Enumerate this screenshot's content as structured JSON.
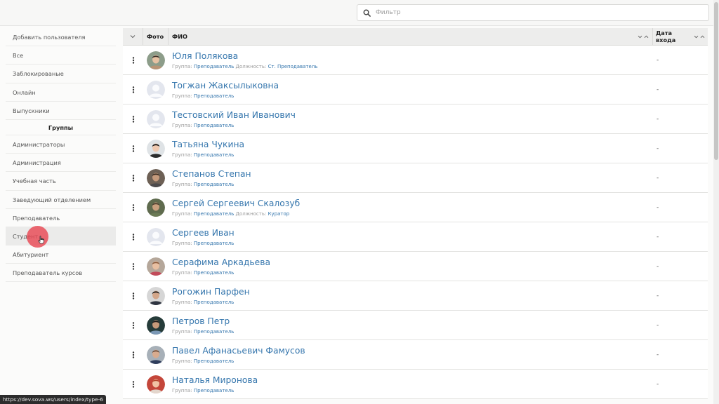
{
  "filter": {
    "placeholder": "Фильтр",
    "value": ""
  },
  "sidebar": {
    "items": [
      {
        "label": "Добавить пользователя"
      },
      {
        "label": "Все"
      },
      {
        "label": "Заблокированые"
      },
      {
        "label": "Онлайн"
      },
      {
        "label": "Выпускники"
      }
    ],
    "groups_header": "Группы",
    "groups": [
      {
        "label": "Администраторы"
      },
      {
        "label": "Администрация"
      },
      {
        "label": "Учебная часть"
      },
      {
        "label": "Заведующий отделением"
      },
      {
        "label": "Преподаватель"
      },
      {
        "label": "Студент",
        "active": true
      },
      {
        "label": "Абитуриент"
      },
      {
        "label": "Преподаватель курсов"
      }
    ]
  },
  "table": {
    "headers": {
      "photo": "Фото",
      "fio": "ФИО",
      "date": "Дата входа"
    },
    "rows": [
      {
        "name": "Юля Полякова",
        "group_label": "Группа:",
        "group": "Преподаватель",
        "position_label": "Должность:",
        "position": "Ст. Преподаватель",
        "date": "-",
        "avatar": "photo-1"
      },
      {
        "name": "Тогжан Жаксылыковна",
        "group_label": "Группа:",
        "group": "Преподаватель",
        "date": "-",
        "avatar": "placeholder"
      },
      {
        "name": "Тестовский Иван Иванович",
        "group_label": "Группа:",
        "group": "Преподаватель",
        "date": "-",
        "avatar": "placeholder"
      },
      {
        "name": "Татьяна Чукина",
        "group_label": "Группа:",
        "group": "Преподаватель",
        "date": "-",
        "avatar": "photo-2"
      },
      {
        "name": "Степанов Степан",
        "group_label": "Группа:",
        "group": "Преподаватель",
        "date": "-",
        "avatar": "photo-3"
      },
      {
        "name": "Сергей Сергеевич Скалозуб",
        "group_label": "Группа:",
        "group": "Преподаватель",
        "position_label": "Должность:",
        "position": "Куратор",
        "date": "-",
        "avatar": "photo-4"
      },
      {
        "name": "Сергеев Иван",
        "group_label": "Группа:",
        "group": "Преподаватель",
        "date": "-",
        "avatar": "placeholder"
      },
      {
        "name": "Серафима Аркадьева",
        "group_label": "Группа:",
        "group": "Преподаватель",
        "date": "-",
        "avatar": "photo-5"
      },
      {
        "name": "Рогожин Парфен",
        "group_label": "Группа:",
        "group": "Преподаватель",
        "date": "-",
        "avatar": "photo-6"
      },
      {
        "name": "Петров Петр",
        "group_label": "Группа:",
        "group": "Преподаватель",
        "date": "-",
        "avatar": "photo-7"
      },
      {
        "name": "Павел Афанасьевич Фамусов",
        "group_label": "Группа:",
        "group": "Преподаватель",
        "date": "-",
        "avatar": "photo-8"
      },
      {
        "name": "Наталья Миронова",
        "group_label": "Группа:",
        "group": "Преподаватель",
        "date": "-",
        "avatar": "photo-9"
      }
    ]
  },
  "statusbar": {
    "url": "https://dev.sova.ws/users/index/type-6"
  },
  "colors": {
    "link": "#3576ad",
    "click_indicator": "#e84854",
    "header_bg": "#ededec"
  }
}
